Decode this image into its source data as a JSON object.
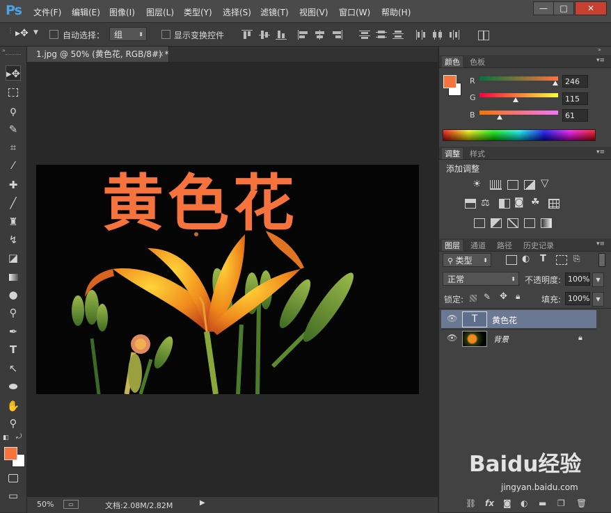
{
  "app": {
    "logo": "Ps"
  },
  "menu": [
    "文件(F)",
    "编辑(E)",
    "图像(I)",
    "图层(L)",
    "类型(Y)",
    "选择(S)",
    "滤镜(T)",
    "视图(V)",
    "窗口(W)",
    "帮助(H)"
  ],
  "window_buttons": {
    "minimize": "—",
    "restore": "□",
    "close": "✕"
  },
  "options": {
    "auto_select_label": "自动选择：",
    "auto_select_value": "组",
    "show_transform_label": "显示变换控件"
  },
  "document": {
    "tab_title": "1.jpg @ 50% (黄色花, RGB/8#) *",
    "tab_close": "×",
    "zoom": "50%",
    "doc_info": "文档:2.08M/2.82M",
    "canvas_text": "黄色花"
  },
  "color_panel": {
    "tabs": [
      "颜色",
      "色板"
    ],
    "channels": [
      {
        "label": "R",
        "value": "246"
      },
      {
        "label": "G",
        "value": "115"
      },
      {
        "label": "B",
        "value": "61"
      }
    ],
    "foreground": "#f6733d",
    "background": "#ffffff"
  },
  "adjust_panel": {
    "tabs": [
      "调整",
      "样式"
    ],
    "title": "添加调整"
  },
  "layers_panel": {
    "tabs": [
      "图层",
      "通道",
      "路径",
      "历史记录"
    ],
    "filter_label": "类型",
    "blend_mode": "正常",
    "opacity_label": "不透明度:",
    "opacity_value": "100%",
    "lock_label": "锁定:",
    "fill_label": "填充:",
    "fill_value": "100%",
    "layers": [
      {
        "name": "黄色花",
        "kind": "text",
        "thumb_glyph": "T",
        "selected": true
      },
      {
        "name": "背景",
        "kind": "image",
        "locked": true
      }
    ]
  },
  "watermark": {
    "brand": "Baidu经验",
    "url": "jingyan.baidu.com"
  }
}
